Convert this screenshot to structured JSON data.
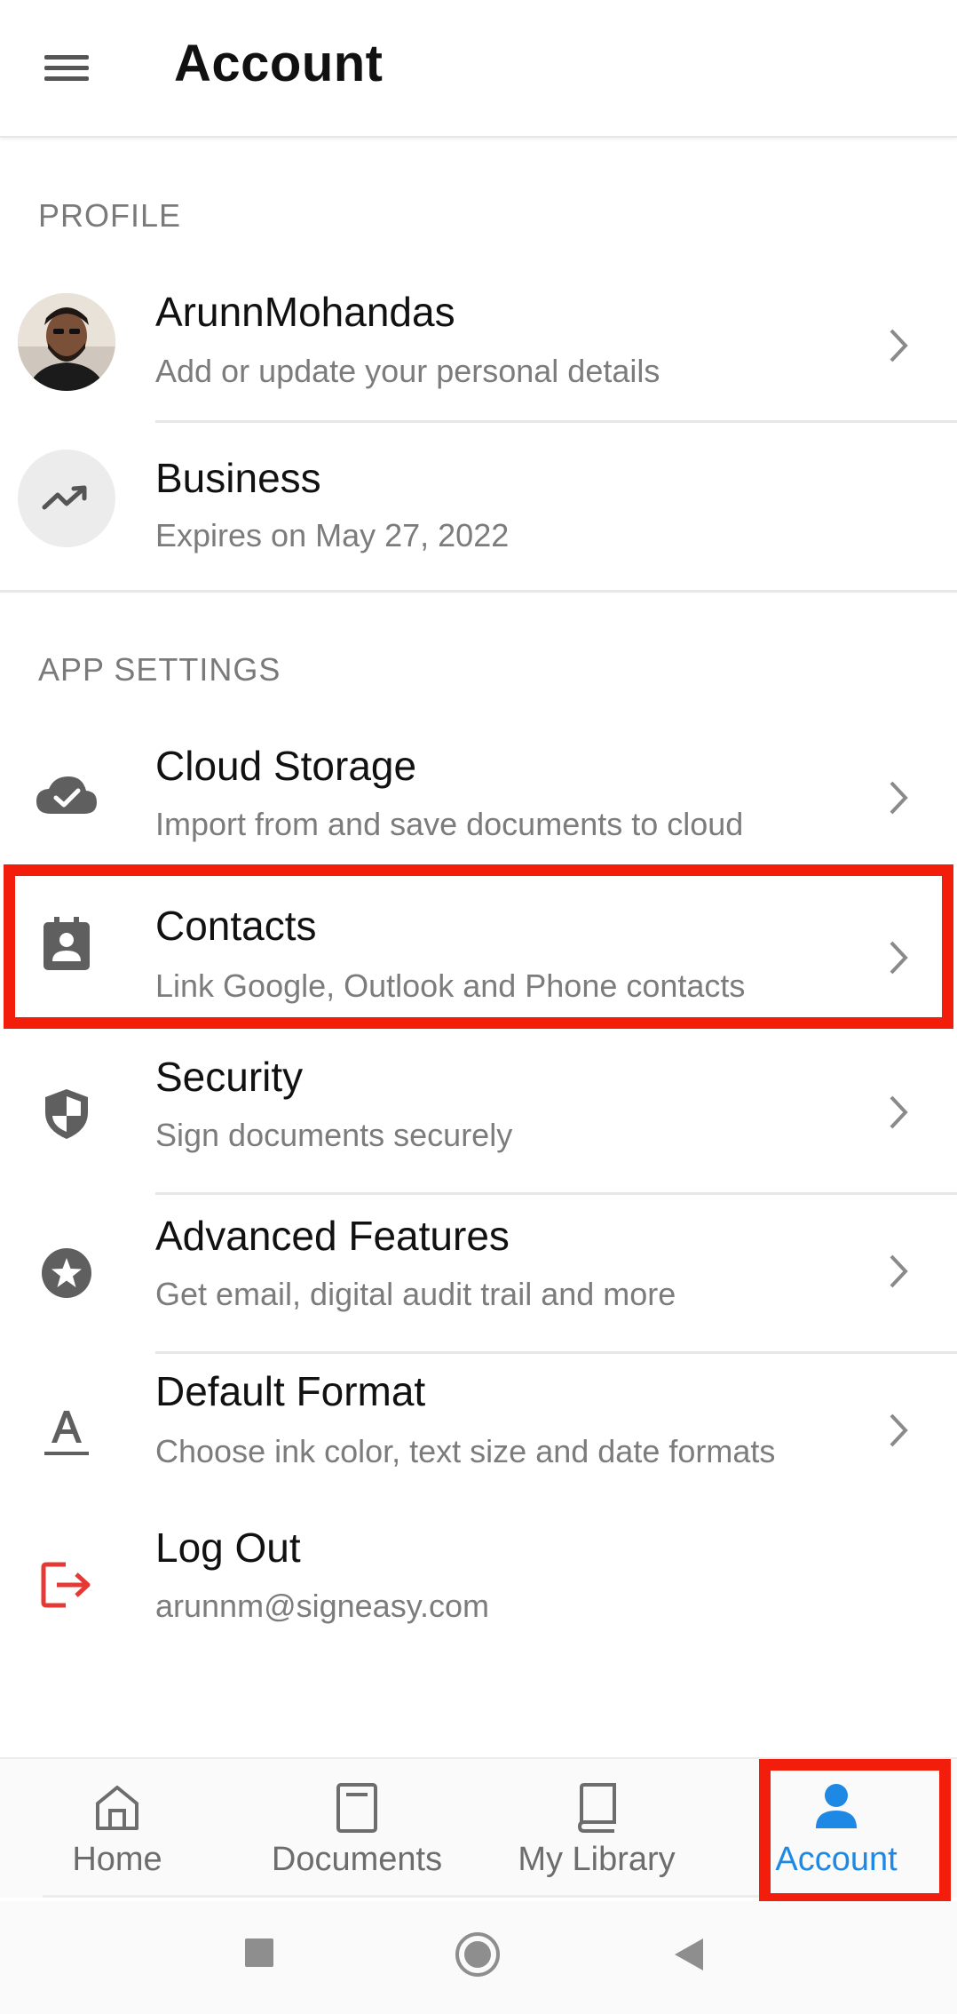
{
  "app_bar": {
    "title": "Account",
    "menu_icon": "hamburger-menu-icon"
  },
  "profile_section": {
    "header": "PROFILE",
    "items": [
      {
        "title": "ArunnMohandas",
        "subtitle": "Add or update your personal details",
        "icon": "avatar-photo"
      },
      {
        "title": "Business",
        "subtitle": "Expires on May 27, 2022",
        "icon": "trending-up-icon"
      }
    ]
  },
  "app_settings_section": {
    "header": "APP SETTINGS",
    "items": [
      {
        "title": "Cloud Storage",
        "subtitle": "Import from and save documents to cloud",
        "icon": "cloud-done-icon"
      },
      {
        "title": "Contacts",
        "subtitle": "Link Google, Outlook and Phone contacts",
        "icon": "contact-card-icon"
      },
      {
        "title": "Security",
        "subtitle": "Sign documents securely",
        "icon": "shield-icon"
      },
      {
        "title": "Advanced Features",
        "subtitle": "Get email, digital audit trail and more",
        "icon": "star-circle-icon"
      },
      {
        "title": "Default Format",
        "subtitle": "Choose ink color, text size and date formats",
        "icon": "text-format-icon"
      },
      {
        "title": "Log Out",
        "subtitle": "arunnm@signeasy.com",
        "icon": "logout-icon"
      }
    ]
  },
  "bottom_nav": {
    "items": [
      {
        "label": "Home",
        "icon": "home-icon"
      },
      {
        "label": "Documents",
        "icon": "document-icon"
      },
      {
        "label": "My Library",
        "icon": "book-icon"
      },
      {
        "label": "Account",
        "icon": "person-icon",
        "active": true
      }
    ]
  },
  "colors": {
    "accent": "#1e88e5",
    "highlight": "#f21d0a",
    "logout_red": "#e53935",
    "icon_gray": "#5f5f5f"
  }
}
